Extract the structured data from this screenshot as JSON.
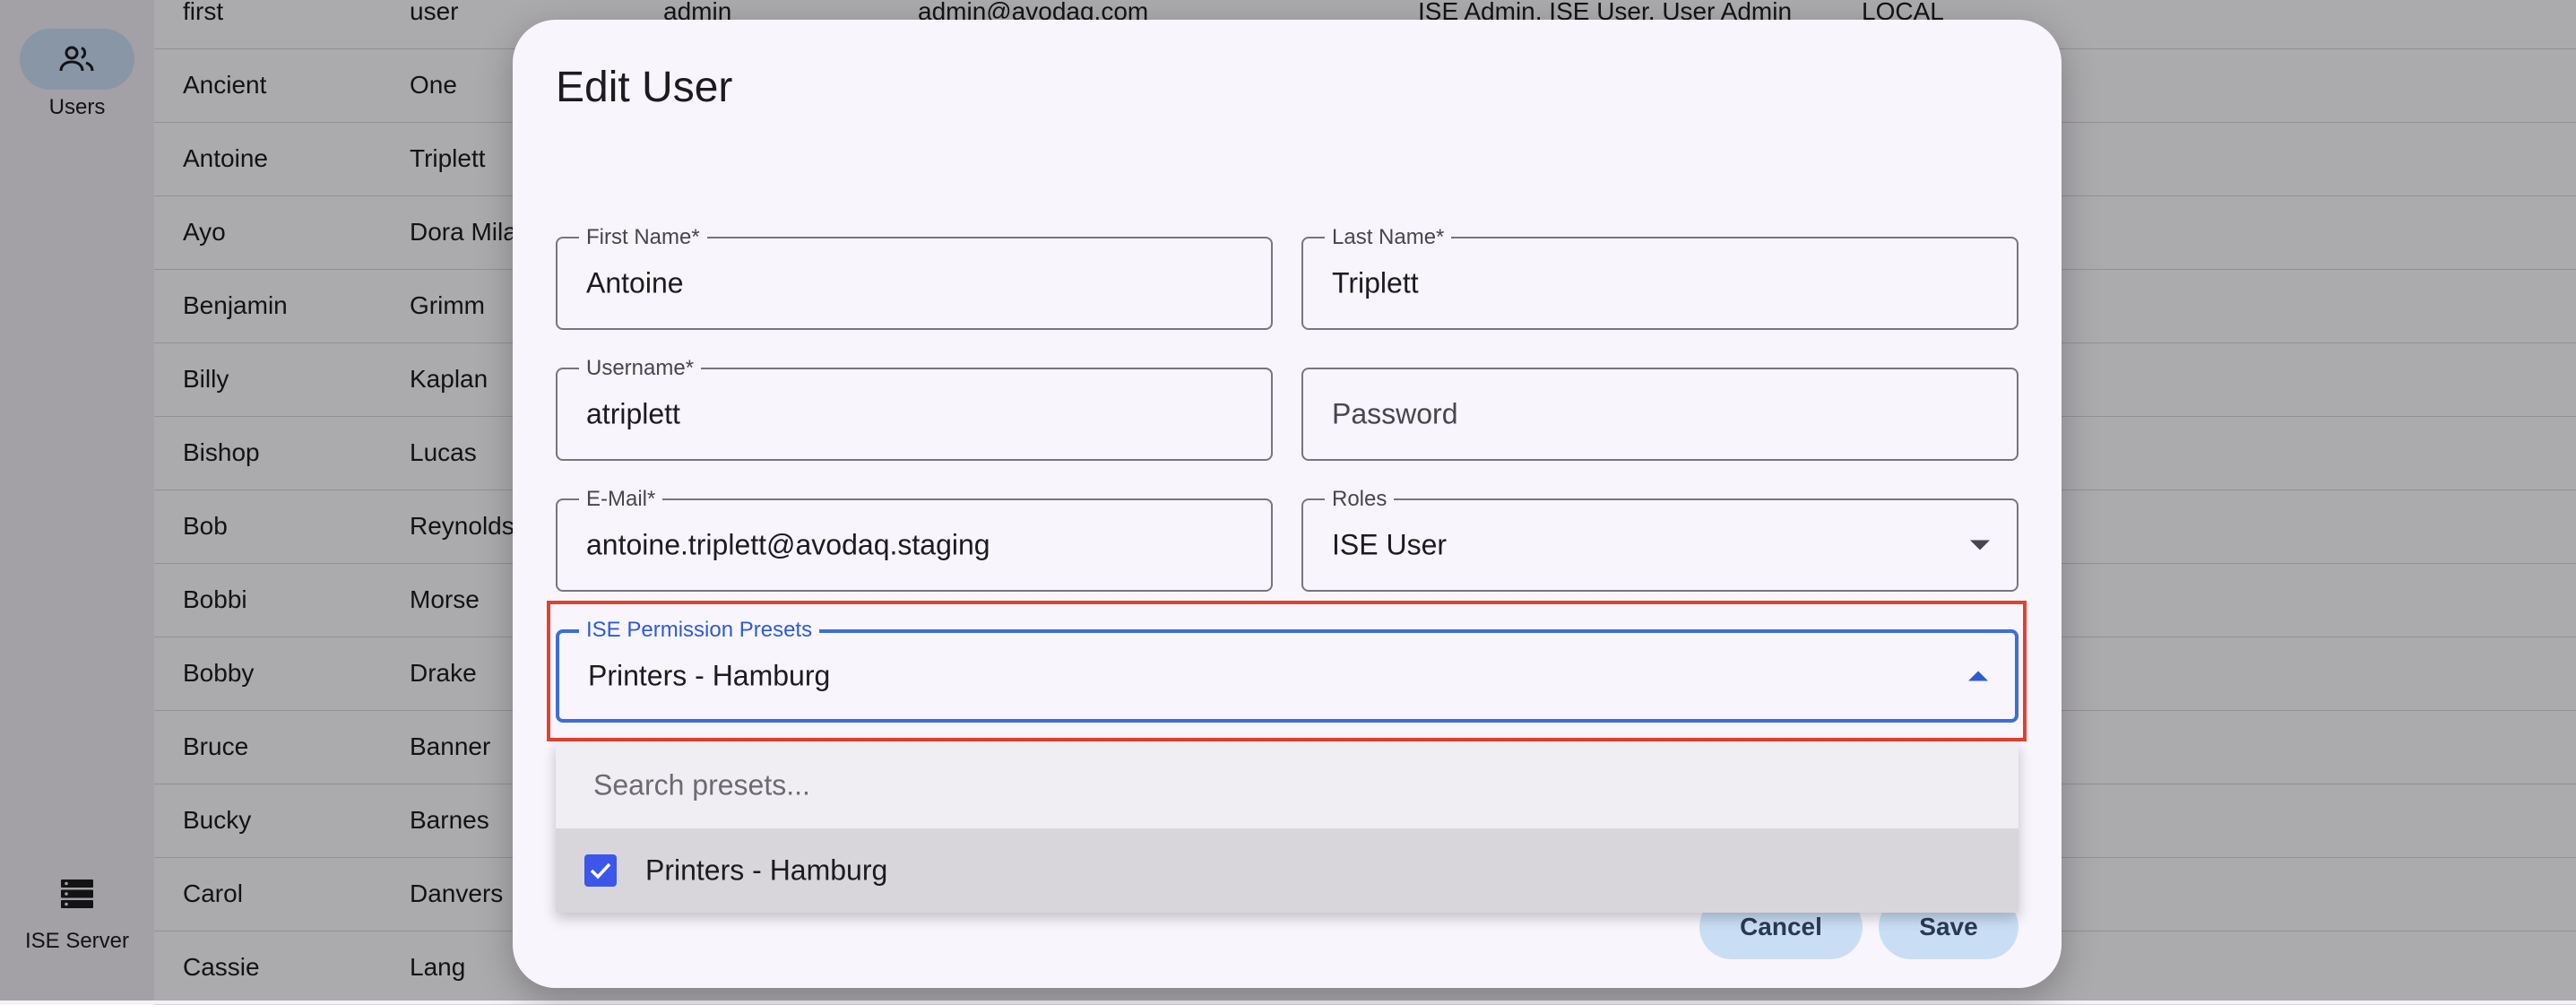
{
  "sidebar": {
    "items": [
      {
        "label": "Users",
        "icon": "users-icon",
        "active": true
      },
      {
        "label": "ISE Server",
        "icon": "server-icon",
        "active": false
      }
    ]
  },
  "table": {
    "rows": [
      {
        "first": "first",
        "last": "user",
        "username": "admin",
        "email": "admin@avodaq.com",
        "roles": "ISE Admin, ISE User, User Admin",
        "source": "LOCAL"
      },
      {
        "first": "Ancient",
        "last": "One",
        "username": "",
        "email": "",
        "roles": "",
        "source": ""
      },
      {
        "first": "Antoine",
        "last": "Triplett",
        "username": "",
        "email": "",
        "roles": "",
        "source": ""
      },
      {
        "first": "Ayo",
        "last": "Dora Mila",
        "username": "",
        "email": "",
        "roles": "",
        "source": ""
      },
      {
        "first": "Benjamin",
        "last": "Grimm",
        "username": "",
        "email": "",
        "roles": "",
        "source": ""
      },
      {
        "first": "Billy",
        "last": "Kaplan",
        "username": "",
        "email": "",
        "roles": "",
        "source": ""
      },
      {
        "first": "Bishop",
        "last": "Lucas",
        "username": "",
        "email": "",
        "roles": "",
        "source": ""
      },
      {
        "first": "Bob",
        "last": "Reynolds",
        "username": "",
        "email": "",
        "roles": "",
        "source": ""
      },
      {
        "first": "Bobbi",
        "last": "Morse",
        "username": "",
        "email": "",
        "roles": "",
        "source": ""
      },
      {
        "first": "Bobby",
        "last": "Drake",
        "username": "",
        "email": "",
        "roles": "",
        "source": ""
      },
      {
        "first": "Bruce",
        "last": "Banner",
        "username": "",
        "email": "",
        "roles": "",
        "source": ""
      },
      {
        "first": "Bucky",
        "last": "Barnes",
        "username": "",
        "email": "",
        "roles": "",
        "source": ""
      },
      {
        "first": "Carol",
        "last": "Danvers",
        "username": "",
        "email": "",
        "roles": "",
        "source": ""
      },
      {
        "first": "Cassie",
        "last": "Lang",
        "username": "",
        "email": "",
        "roles": "",
        "source": ""
      }
    ]
  },
  "dialog": {
    "title": "Edit User",
    "fields": {
      "first_name": {
        "label": "First Name*",
        "value": "Antoine"
      },
      "last_name": {
        "label": "Last Name*",
        "value": "Triplett"
      },
      "username": {
        "label": "Username*",
        "value": "atriplett"
      },
      "password": {
        "placeholder": "Password",
        "value": ""
      },
      "email": {
        "label": "E-Mail*",
        "value": "antoine.triplett@avodaq.staging"
      },
      "roles": {
        "label": "Roles",
        "value": "ISE User"
      },
      "presets": {
        "label": "ISE Permission Presets",
        "value": "Printers - Hamburg"
      }
    },
    "dropdown": {
      "search_placeholder": "Search presets...",
      "options": [
        {
          "label": "Printers - Hamburg",
          "checked": true
        }
      ]
    },
    "buttons": {
      "cancel": "Cancel",
      "save": "Save"
    }
  },
  "colors": {
    "accent": "#2d5bd7",
    "checkbox": "#3b56e8",
    "highlight": "#e2412f",
    "button_bg": "#c9def4"
  }
}
